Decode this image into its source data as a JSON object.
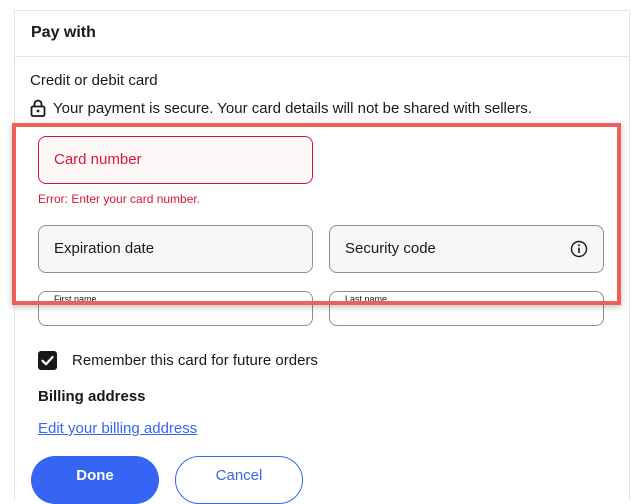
{
  "section": {
    "title": "Pay with"
  },
  "payment_method": {
    "label": "Credit or debit card",
    "secure_note": "Your payment is secure. Your card details will not be shared with sellers."
  },
  "fields": {
    "card_number": {
      "label": "Card number",
      "error": "Error: Enter your card number.",
      "state": "error"
    },
    "expiration": {
      "label": "Expiration date"
    },
    "security_code": {
      "label": "Security code",
      "icon": "info-icon"
    },
    "first_name": {
      "label": "First name"
    },
    "last_name": {
      "label": "Last name"
    }
  },
  "remember": {
    "label": "Remember this card for future orders",
    "checked": true
  },
  "billing": {
    "heading": "Billing address",
    "link": "Edit your billing address"
  },
  "actions": {
    "done": "Done",
    "cancel": "Cancel"
  },
  "colors": {
    "accent": "#3665f3",
    "error": "#e0103a",
    "highlight": "#f0605a"
  }
}
